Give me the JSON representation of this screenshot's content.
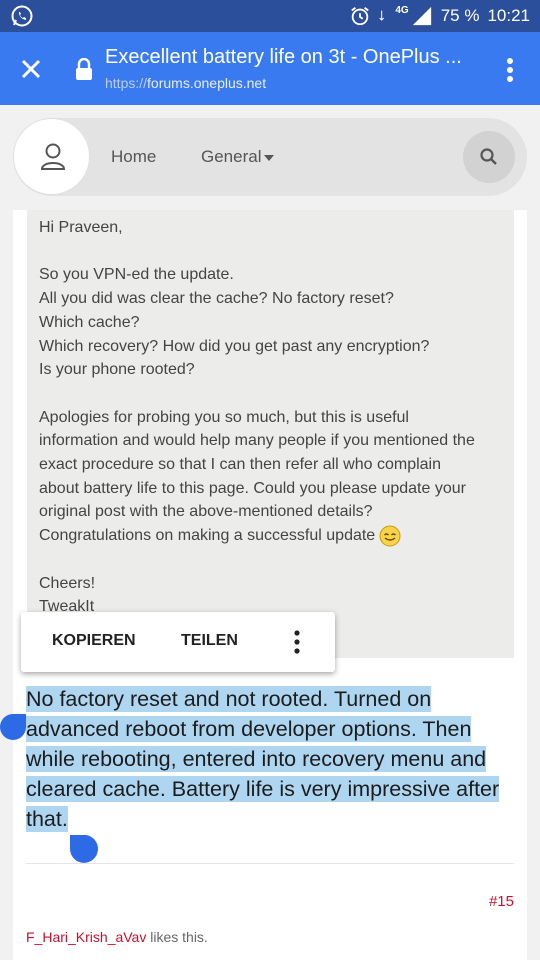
{
  "status_bar": {
    "network": "4G",
    "battery": "75 %",
    "time": "10:21",
    "icons": [
      "whatsapp-icon",
      "alarm-icon",
      "data-arrows-icon",
      "signal-icon",
      "battery-icon"
    ]
  },
  "app_bar": {
    "title": "Execellent battery life on 3t - OnePlus ...",
    "url_protocol": "https://",
    "url_host": "forums.oneplus.net",
    "color": "#3a7af0"
  },
  "nav": {
    "home": "Home",
    "general": "General"
  },
  "quote": {
    "lines_1": [
      "Hi Praveen,"
    ],
    "lines_2": [
      "So you VPN-ed the update.",
      "All you did was clear the cache? No factory reset?",
      "Which cache?",
      "Which recovery? How did you get past any encryption?",
      "Is your phone rooted?"
    ],
    "lines_3": [
      "Apologies for probing you so much, but this is useful",
      "information and would help many people if you mentioned the",
      "exact procedure so that I can then refer all who complain",
      "about battery life to this page. Could you please update your",
      "original post with the above-mentioned details?"
    ],
    "congrats": "Congratulations on making a successful update",
    "lines_4": [
      "Cheers!",
      "TweakIt"
    ]
  },
  "context_menu": {
    "copy": "KOPIEREN",
    "share": "TEILEN"
  },
  "reply": {
    "text": "No factory reset and not rooted. Turned on advanced reboot from developer options. Then while rebooting, entered into recovery menu and cleared cache. Battery life is very impressive after that.",
    "highlight_color": "#aed6f1"
  },
  "post": {
    "number": "#15",
    "liker": "F_Hari_Krish_aVav",
    "likes_suffix": " likes this."
  }
}
